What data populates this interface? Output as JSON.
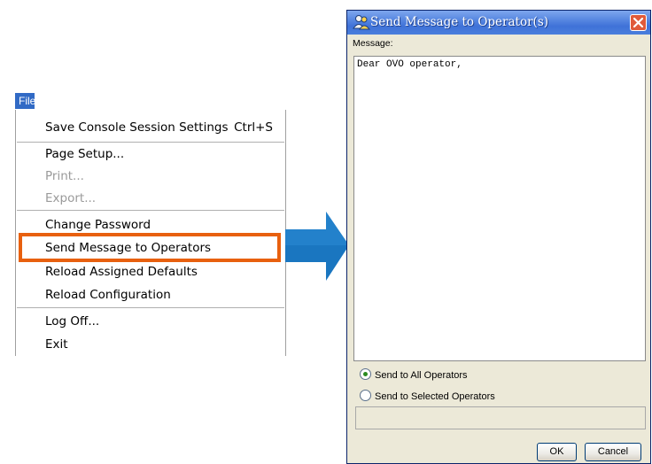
{
  "menu": {
    "title": "File",
    "items": [
      {
        "label": "Save Console Session Settings",
        "shortcut": "Ctrl+S",
        "enabled": true
      },
      {
        "label": "Page Setup...",
        "enabled": true
      },
      {
        "label": "Print...",
        "enabled": false
      },
      {
        "label": "Export...",
        "enabled": false
      },
      {
        "label": "Change Password",
        "enabled": true
      },
      {
        "label": "Send Message to Operators",
        "enabled": true,
        "highlighted": true
      },
      {
        "label": "Reload Assigned Defaults",
        "enabled": true
      },
      {
        "label": "Reload Configuration",
        "enabled": true
      },
      {
        "label": "Log Off...",
        "enabled": true
      },
      {
        "label": "Exit",
        "enabled": true
      }
    ]
  },
  "dialog": {
    "title": "Send Message to Operator(s)",
    "message_label": "Message:",
    "message_text": "Dear OVO operator,",
    "radio_all": {
      "label": "Send to All Operators",
      "checked": true
    },
    "radio_selected": {
      "label": "Send to Selected Operators",
      "checked": false
    },
    "selected_operators_value": "",
    "ok_label": "OK",
    "cancel_label": "Cancel"
  },
  "colors": {
    "highlight_border": "#e8600f",
    "arrow": "#1a76c0",
    "titlebar": "#4a7edc",
    "menu_title_bg": "#316ac5"
  },
  "icons": {
    "title_icon": "operator-people-icon",
    "close_icon": "close-x-icon",
    "arrow": "right-arrow"
  }
}
